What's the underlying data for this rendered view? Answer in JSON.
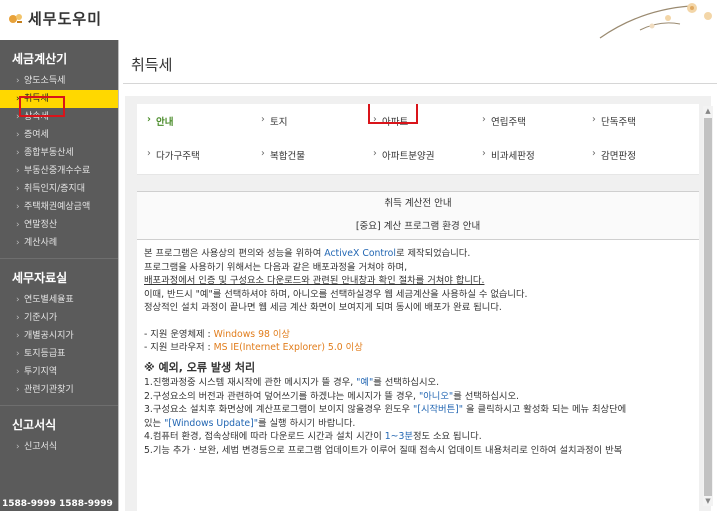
{
  "header": {
    "logo_text": "세무도우미"
  },
  "sidebar": {
    "sections": [
      {
        "title": "세금계산기",
        "items": [
          "양도소득세",
          "취득세",
          "상속세",
          "증여세",
          "종합부동산세",
          "부동산중개수수료",
          "취득인지/증지대",
          "주택채권예상금액",
          "연말정산",
          "계산사례"
        ]
      },
      {
        "title": "세무자료실",
        "items": [
          "연도별세율표",
          "기준시가",
          "개별공시지가",
          "토지등급표",
          "투기지역",
          "관련기관찾기"
        ]
      },
      {
        "title": "신고서식",
        "items": [
          "신고서식"
        ]
      }
    ],
    "active_item": "취득세",
    "phones": "1588-9999   1588-9999"
  },
  "main": {
    "title": "취득세",
    "tabs": [
      [
        "안내",
        "토지",
        "아파트",
        "연립주택",
        "단독주택"
      ],
      [
        "다가구주택",
        "복합건물",
        "아파트분양권",
        "비과세판정",
        "감면판정"
      ]
    ],
    "active_tab": "안내",
    "info_head1": "취득 계산전 안내",
    "info_head2": "[중요] 계산 프로그램 환경 안내",
    "body": {
      "p1_a": "본 프로그램은 사용상의 편의와 성능을 위하여 ",
      "p1_b": "ActiveX Control",
      "p1_c": "로 제작되었습니다.",
      "p2": "프로그램을 사용하기 위해서는 다음과 같은 배포과정을 거쳐야 하며,",
      "p3": "배포과정에서 인증 및 구성요소 다운로드와 관련된 안내창과 확인 절차를 거쳐야 합니다.",
      "p4": "이때, 반드시 \"예\"를 선택하셔야 하며, 아니오를 선택하실경우 웹 세금계산을 사용하실 수 없습니다.",
      "p5": "정상적인 설치 과정이 끝나면 웹 세금 계산 화면이 보여지게 되며 동시에 배포가 완료 됩니다.",
      "os_label": "- 지원 운영체제 : ",
      "os_value": "Windows 98 이상",
      "br_label": "- 지원 브라우저 : ",
      "br_value": "MS IE(Internet Explorer) 5.0 이상",
      "err_title": "※ 예외, 오류 발생 처리",
      "e1_a": "1.진행과정중 시스템 재시작에 관한 메시지가 뜰 경우, ",
      "e1_b": "\"예\"",
      "e1_c": "를 선택하십시오.",
      "e2_a": "2.구성요소의 버전과 관련하여 덮어쓰기를 하겠냐는 메시지가 뜰 경우, ",
      "e2_b": "\"아니오\"",
      "e2_c": "를 선택하십시오.",
      "e3_a": "3.구성요소 설치후 화면상에 계산프로그램이 보이지 않을경우 윈도우 ",
      "e3_b": "\"[시작버튼]\"",
      "e3_c": " 을 클릭하시고 활성화 되는 메뉴 최상단에",
      "e3_d": "   있는 ",
      "e3_e": "\"[Windows Update]\"",
      "e3_f": "를 실행 하시기 바랍니다.",
      "e4_a": "4.컴퓨터 환경, 접속상태에 따라 다운로드 시간과 설치 시간이 ",
      "e4_b": "1~3분",
      "e4_c": "정도 소요 됩니다.",
      "e5": "5.기능 추가 · 보완, 세법 변경등으로 프로그램 업데이트가 이루어 질때 접속시 업데이트 내용처리로 인하여 설치과정이 반복"
    }
  },
  "colors": {
    "sidebar_bg": "#5b5b5b",
    "active_bg": "#ffd800",
    "highlight_box": "#d9141a",
    "active_tab": "#4a8c2a",
    "link_blue": "#2367b3",
    "value_orange": "#e17d1c"
  }
}
